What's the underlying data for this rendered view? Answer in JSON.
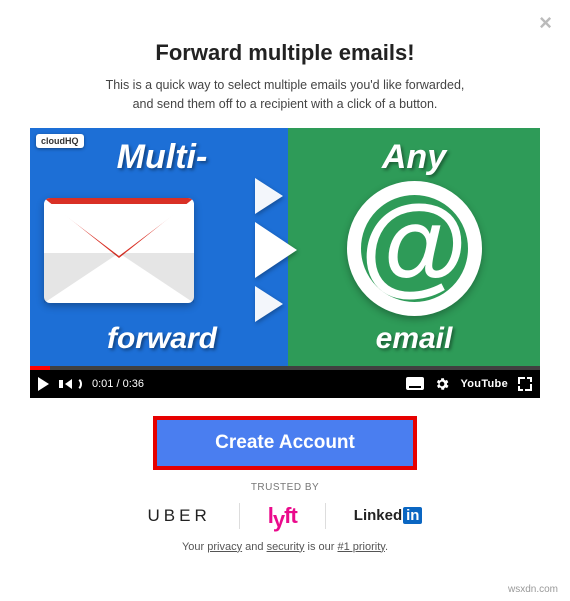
{
  "close_aria": "Close",
  "title": "Forward multiple emails!",
  "subtitle_line1": "This is a quick way to select multiple emails you'd like forwarded,",
  "subtitle_line2": "and send them off to a recipient with a click of a button.",
  "video": {
    "badge": "cloudHQ",
    "left_top": "Multi-",
    "left_bottom": "forward",
    "right_top": "Any",
    "right_bottom": "email",
    "at": "@",
    "current_time": "0:01",
    "duration": "0:36",
    "youtube_label": "YouTube"
  },
  "cta_label": "Create Account",
  "trusted_label": "TRUSTED BY",
  "logos": {
    "uber": "UBER",
    "lyft": "lyft",
    "linkedin_text": "Linked",
    "linkedin_in": "in"
  },
  "footer": {
    "pre": "Your ",
    "privacy": "privacy",
    "and": " and ",
    "security": "security",
    "mid": " is our ",
    "priority": "#1 priority",
    "end": "."
  },
  "watermark": "wsxdn.com"
}
